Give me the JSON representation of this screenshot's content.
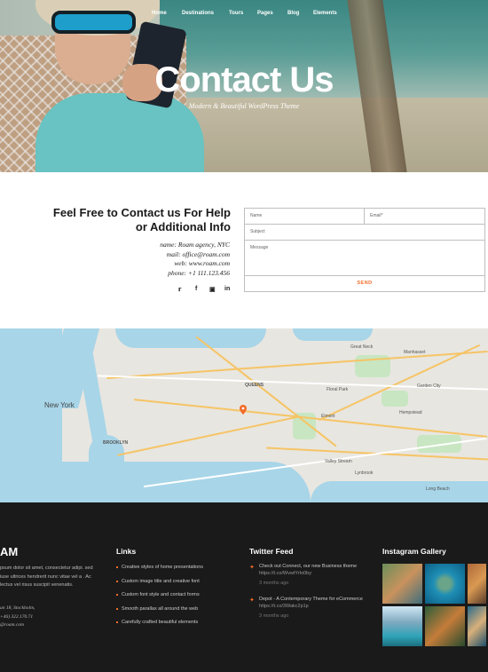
{
  "nav": {
    "items": [
      "Home",
      "Destinations",
      "Tours",
      "Pages",
      "Blog",
      "Elements"
    ]
  },
  "hero": {
    "title": "Contact Us",
    "subtitle": "Modern & Beautiful WordPress Theme"
  },
  "contact": {
    "heading_line1": "Feel Free to Contact us For Help",
    "heading_line2": "or Additional Info",
    "name": "name: Roam agency, NYC",
    "mail": "mail: office@roam.com",
    "web": "web: www.roam.com",
    "phone": "phone: +1 111.123.456",
    "social": [
      "twitter-icon",
      "facebook-icon",
      "instagram-icon",
      "linkedin-icon"
    ]
  },
  "form": {
    "name_placeholder": "Name",
    "email_placeholder": "Email*",
    "subject_placeholder": "Subject",
    "message_placeholder": "Message",
    "send_label": "SEND"
  },
  "map": {
    "labels": {
      "new_york": "New York",
      "queens": "QUEENS",
      "brooklyn": "BROOKLYN",
      "elmont": "Elmont",
      "valley_stream": "Valley Stream",
      "hempstead": "Hempstead",
      "great_neck": "Great Neck",
      "manhasset": "Manhasset",
      "floral_park": "Floral Park",
      "garden_city": "Garden City",
      "lynbrook": "Lynbrook",
      "long_beach": "Long Beach"
    }
  },
  "footer": {
    "logo": "AM",
    "about": "psum dolor sit amet, consectetur adipi. sed iuse ultrices hendrerit nunc vitae vel a . Ac lectus vel risus suscipit venenatis.",
    "address": "an 18, Stockholm,",
    "phone": "+46) 322.170.71",
    "email": "@roam.com",
    "links_title": "Links",
    "links": [
      "Creative styles of home presentations",
      "Custom image title and creative font",
      "Custom font style and contact forms",
      "Smooth parallax all around the web",
      "Carefully crafted beautiful elements"
    ],
    "twitter_title": "Twitter Feed",
    "tweets": [
      {
        "text": "Check out Connect, our new Business theme",
        "link": "https://t.co/WvwtYrlo0by",
        "date": "3 months ago"
      },
      {
        "text": "Depot - A Contemporary Theme for eCommerce",
        "link": "https://t.co/3Wakc2p1p",
        "date": "3 months ago"
      }
    ],
    "instagram_title": "Instagram Gallery"
  },
  "colors": {
    "accent": "#f26b2a",
    "footer_bg": "#1a1a1a",
    "map_water": "#a8d5e8"
  }
}
